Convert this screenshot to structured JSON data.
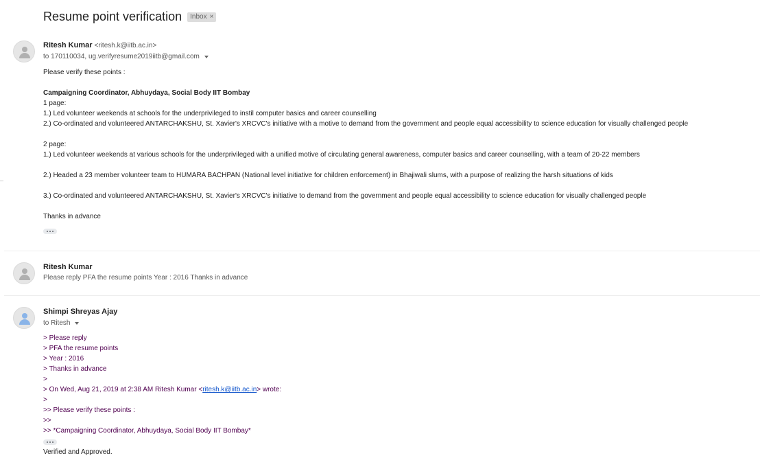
{
  "thread": {
    "subject": "Resume point verification",
    "label": "Inbox",
    "label_remove_icon": "×"
  },
  "message1": {
    "sender_name": "Ritesh Kumar",
    "sender_email": "<ritesh.k@iitb.ac.in>",
    "recipients": "to 170110034, ug.verifyresume2019iitb@gmail.com",
    "body": {
      "greeting": "Please verify these points :",
      "heading": "Campaigning Coordinator, Abhuydaya, Social Body IIT Bombay",
      "one_page_label": "1 page:",
      "one_page_1": "1.) Led volunteer weekends at schools for the underprivileged to instil computer basics and career counselling",
      "one_page_2": "2.) Co-ordinated and volunteered ANTARCHAKSHU, St. Xavier's XRCVC's initiative with a motive to demand from the government and people equal accessibility to science education for visually challenged people",
      "two_page_label": "2 page:",
      "two_page_1": "1.) Led volunteer weekends at various schools for the underprivileged with a unified motive of circulating general awareness, computer basics and career counselling, with a team of 20-22 members",
      "two_page_2": "2.) Headed a 23 member volunteer team to HUMARA BACHPAN (National level initiative for children enforcement) in Bhajiwali slums, with a purpose of realizing the harsh situations of kids",
      "two_page_3": "3.) Co-ordinated and volunteered ANTARCHAKSHU, St. Xavier's XRCVC's initiative to demand from the government and people equal accessibility to science education for visually challenged people",
      "closing": "Thanks in advance"
    }
  },
  "message2": {
    "sender_name": "Ritesh Kumar",
    "snippet": "Please reply PFA the resume points Year : 2016 Thanks in advance"
  },
  "message3": {
    "sender_name": "Shimpi Shreyas Ajay",
    "recipients": "to Ritesh",
    "quoted": {
      "l1": "> Please reply",
      "l2": "> PFA the resume points",
      "l3": "> Year : 2016",
      "l4": "> Thanks in advance",
      "l5": ">",
      "l6_prefix": "> On Wed, Aug 21, 2019 at 2:38 AM Ritesh Kumar <",
      "l6_link": "ritesh.k@iitb.ac.in",
      "l6_suffix": "> wrote:",
      "l7": ">",
      "l8": ">> Please verify these points :",
      "l9": ">>",
      "l10": ">> *Campaigning Coordinator, Abhuydaya, Social Body IIT Bombay*"
    },
    "reply": "Verified and Approved."
  },
  "icons": {
    "avatar": "default-person-avatar",
    "caret": "chevron-down-icon",
    "ellipsis": "show-trimmed-content-icon"
  },
  "colors": {
    "quote_text": "#500050",
    "link": "#1155cc",
    "label_chip_bg": "#dddddd"
  }
}
